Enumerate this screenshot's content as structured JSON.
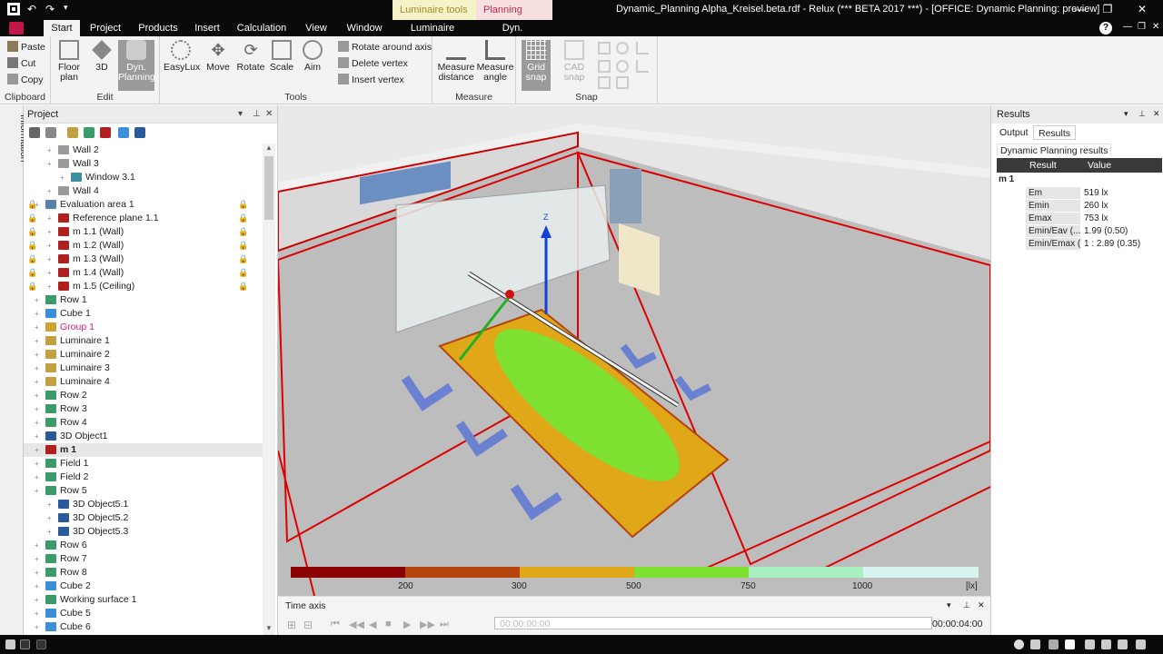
{
  "titlebar": {
    "window_title": "Dynamic_Planning Alpha_Kreisel.beta.rdf - Relux (*** BETA 2017 ***) - [OFFICE: Dynamic Planning: preview]",
    "context_tabs": [
      "Luminaire tools",
      "Planning Tools"
    ],
    "min_glyph": "—",
    "max_glyph": "❐",
    "close_glyph": "✕"
  },
  "menubar": {
    "tabs": [
      "Start",
      "Project",
      "Products",
      "Insert",
      "Calculation",
      "View",
      "Window",
      "Luminaire",
      "Dyn. Planning"
    ],
    "help_glyph": "?"
  },
  "ribbon": {
    "clipboard": {
      "label": "Clipboard",
      "paste": "Paste",
      "cut": "Cut",
      "copy": "Copy"
    },
    "edit": {
      "label": "Edit",
      "floor_plan": "Floor plan",
      "three_d": "3D",
      "dyn_planning": "Dyn. Planning"
    },
    "tools": {
      "label": "Tools",
      "easylux": "EasyLux",
      "move": "Move",
      "rotate": "Rotate",
      "scale": "Scale",
      "aim": "Aim",
      "rotate_axis": "Rotate around axis",
      "delete_vertex": "Delete vertex",
      "insert_vertex": "Insert vertex"
    },
    "measure": {
      "label": "Measure",
      "distance": "Measure distance",
      "angle": "Measure angle"
    },
    "snap": {
      "label": "Snap",
      "grid": "Grid snap",
      "cad": "CAD snap"
    }
  },
  "left_strip": {
    "label": "Information"
  },
  "project_panel": {
    "title": "Project",
    "tree": [
      {
        "label": "Wall 2",
        "indent": 2,
        "icon": "wall-icon",
        "color": "#9a9a9a"
      },
      {
        "label": "Wall 3",
        "indent": 2,
        "icon": "wall-icon",
        "color": "#9a9a9a"
      },
      {
        "label": "Window 3.1",
        "indent": 3,
        "icon": "window-icon",
        "color": "#3a8fa0"
      },
      {
        "label": "Wall 4",
        "indent": 2,
        "icon": "wall-icon",
        "color": "#9a9a9a"
      },
      {
        "label": "Evaluation area 1",
        "indent": 1,
        "icon": "evaluation-icon",
        "color": "#5a7fa8",
        "lock": true
      },
      {
        "label": "Reference plane 1.1",
        "indent": 2,
        "icon": "plane-icon",
        "color": "#b02020",
        "lock": true
      },
      {
        "label": "m 1.1 (Wall)",
        "indent": 2,
        "icon": "plane-icon",
        "color": "#b02020",
        "lock": true
      },
      {
        "label": "m 1.2 (Wall)",
        "indent": 2,
        "icon": "plane-icon",
        "color": "#b02020",
        "lock": true
      },
      {
        "label": "m 1.3 (Wall)",
        "indent": 2,
        "icon": "plane-icon",
        "color": "#b02020",
        "lock": true
      },
      {
        "label": "m 1.4 (Wall)",
        "indent": 2,
        "icon": "plane-icon",
        "color": "#b02020",
        "lock": true
      },
      {
        "label": "m 1.5 (Ceiling)",
        "indent": 2,
        "icon": "plane-icon",
        "color": "#b02020",
        "lock": true
      },
      {
        "label": "Row 1",
        "indent": 1,
        "icon": "row-icon",
        "color": "#3a9a6a"
      },
      {
        "label": "Cube 1",
        "indent": 1,
        "icon": "cube-icon",
        "color": "#3a8fd8"
      },
      {
        "label": "Group 1",
        "indent": 1,
        "icon": "group-icon",
        "color": "#d0a030",
        "text_color": "#d01a8a"
      },
      {
        "label": "Luminaire 1",
        "indent": 1,
        "icon": "luminaire-icon",
        "color": "#c0a040"
      },
      {
        "label": "Luminaire 2",
        "indent": 1,
        "icon": "luminaire-icon",
        "color": "#c0a040"
      },
      {
        "label": "Luminaire 3",
        "indent": 1,
        "icon": "luminaire-icon",
        "color": "#c0a040"
      },
      {
        "label": "Luminaire 4",
        "indent": 1,
        "icon": "luminaire-icon",
        "color": "#c0a040"
      },
      {
        "label": "Row 2",
        "indent": 1,
        "icon": "row-icon",
        "color": "#3a9a6a"
      },
      {
        "label": "Row 3",
        "indent": 1,
        "icon": "row-icon",
        "color": "#3a9a6a"
      },
      {
        "label": "Row 4",
        "indent": 1,
        "icon": "row-icon",
        "color": "#3a9a6a"
      },
      {
        "label": "3D Object1",
        "indent": 1,
        "icon": "object-icon",
        "color": "#2a5a9a"
      },
      {
        "label": "m 1",
        "indent": 1,
        "icon": "plane-icon",
        "color": "#b02020",
        "bold": true,
        "selected": true
      },
      {
        "label": "Field 1",
        "indent": 1,
        "icon": "field-icon",
        "color": "#3a9a6a"
      },
      {
        "label": "Field 2",
        "indent": 1,
        "icon": "field-icon",
        "color": "#3a9a6a"
      },
      {
        "label": "Row 5",
        "indent": 1,
        "icon": "row-icon",
        "color": "#3a9a6a"
      },
      {
        "label": "3D Object5.1",
        "indent": 2,
        "icon": "object-icon",
        "color": "#2a5a9a"
      },
      {
        "label": "3D Object5.2",
        "indent": 2,
        "icon": "object-icon",
        "color": "#2a5a9a"
      },
      {
        "label": "3D Object5.3",
        "indent": 2,
        "icon": "object-icon",
        "color": "#2a5a9a"
      },
      {
        "label": "Row 6",
        "indent": 1,
        "icon": "row-icon",
        "color": "#3a9a6a"
      },
      {
        "label": "Row 7",
        "indent": 1,
        "icon": "row-icon",
        "color": "#3a9a6a"
      },
      {
        "label": "Row 8",
        "indent": 1,
        "icon": "row-icon",
        "color": "#3a9a6a"
      },
      {
        "label": "Cube 2",
        "indent": 1,
        "icon": "cube-icon",
        "color": "#3a8fd8"
      },
      {
        "label": "Working surface 1",
        "indent": 1,
        "icon": "surface-icon",
        "color": "#3a9a6a"
      },
      {
        "label": "Cube 5",
        "indent": 1,
        "icon": "cube-icon",
        "color": "#3a8fd8"
      },
      {
        "label": "Cube 6",
        "indent": 1,
        "icon": "cube-icon",
        "color": "#3a8fd8"
      }
    ]
  },
  "viewport": {
    "legend": {
      "colors": [
        "#8b0000",
        "#b5440f",
        "#e0a818",
        "#7ee030",
        "#a8f0c0",
        "#d8f4f0"
      ],
      "ticks": [
        "200",
        "300",
        "500",
        "750",
        "1000"
      ],
      "unit": "[lx]"
    }
  },
  "time_axis": {
    "title": "Time axis",
    "start": "00:00:00:00",
    "end": "00:00:04:00"
  },
  "results_panel": {
    "title": "Results",
    "tabs": [
      "Output",
      "Results"
    ],
    "subtitle": "Dynamic Planning results",
    "col_result": "Result",
    "col_value": "Value",
    "group": "m 1",
    "rows": [
      {
        "key": "Em",
        "value": "519 lx"
      },
      {
        "key": "Emin",
        "value": "260 lx"
      },
      {
        "key": "Emax",
        "value": "753 lx"
      },
      {
        "key": "Emin/Eav (...",
        "value": "1.99 (0.50)"
      },
      {
        "key": "Emin/Emax (...",
        "value": "1 : 2.89 (0.35)"
      }
    ]
  }
}
